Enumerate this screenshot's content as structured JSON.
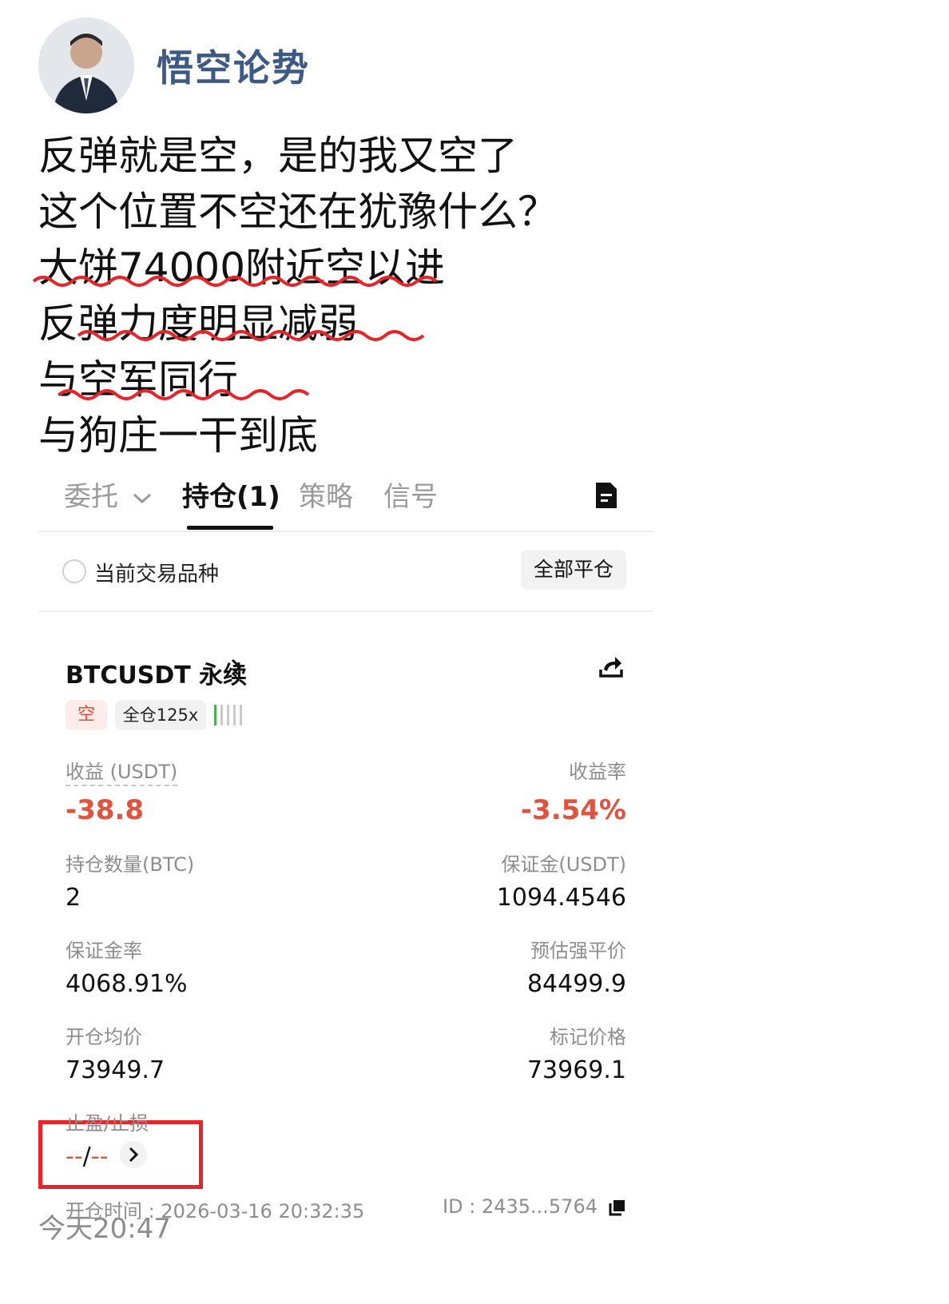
{
  "author": {
    "name": "悟空论势",
    "avatar_icon": "person-avatar"
  },
  "post": {
    "lines": [
      "反弹就是空，是的我又空了",
      "这个位置不空还在犹豫什么？",
      "大饼74000附近空以进",
      "反弹力度明显减弱",
      "与空军同行",
      "与狗庄一干到底"
    ],
    "time": "今天20:47"
  },
  "tabs": {
    "items": [
      "委托",
      "持仓(1)",
      "策略",
      "信号"
    ],
    "active_index": 1
  },
  "filter": {
    "label": "当前交易品种",
    "close_all": "全部平仓"
  },
  "position": {
    "symbol": "BTCUSDT 永续",
    "side_badge": "空",
    "leverage_badge": "全仓125x",
    "pnl_label": "收益 (USDT)",
    "pnl_value": "-38.8",
    "roe_label": "收益率",
    "roe_value": "-3.54%",
    "size_label": "持仓数量(BTC)",
    "size_value": "2",
    "margin_label": "保证金(USDT)",
    "margin_value": "1094.4546",
    "margin_ratio_label": "保证金率",
    "margin_ratio_value": "4068.91%",
    "liq_label": "预估强平价",
    "liq_value": "84499.9",
    "entry_label": "开仓均价",
    "entry_value": "73949.7",
    "mark_label": "标记价格",
    "mark_value": "73969.1",
    "tpsl_label": "止盈/止损",
    "tp_value": "--",
    "sl_separator": "/",
    "sl_value": "--",
    "open_time": "开仓时间 : 2026-03-16 20:32:35",
    "id_text": "ID : 2435...5764"
  },
  "colors": {
    "loss": "#e0533f",
    "author": "#3d5a86",
    "highlight_box": "#e8232a",
    "squiggle": "#e8232a",
    "leverage_bar": "#4caf50"
  }
}
